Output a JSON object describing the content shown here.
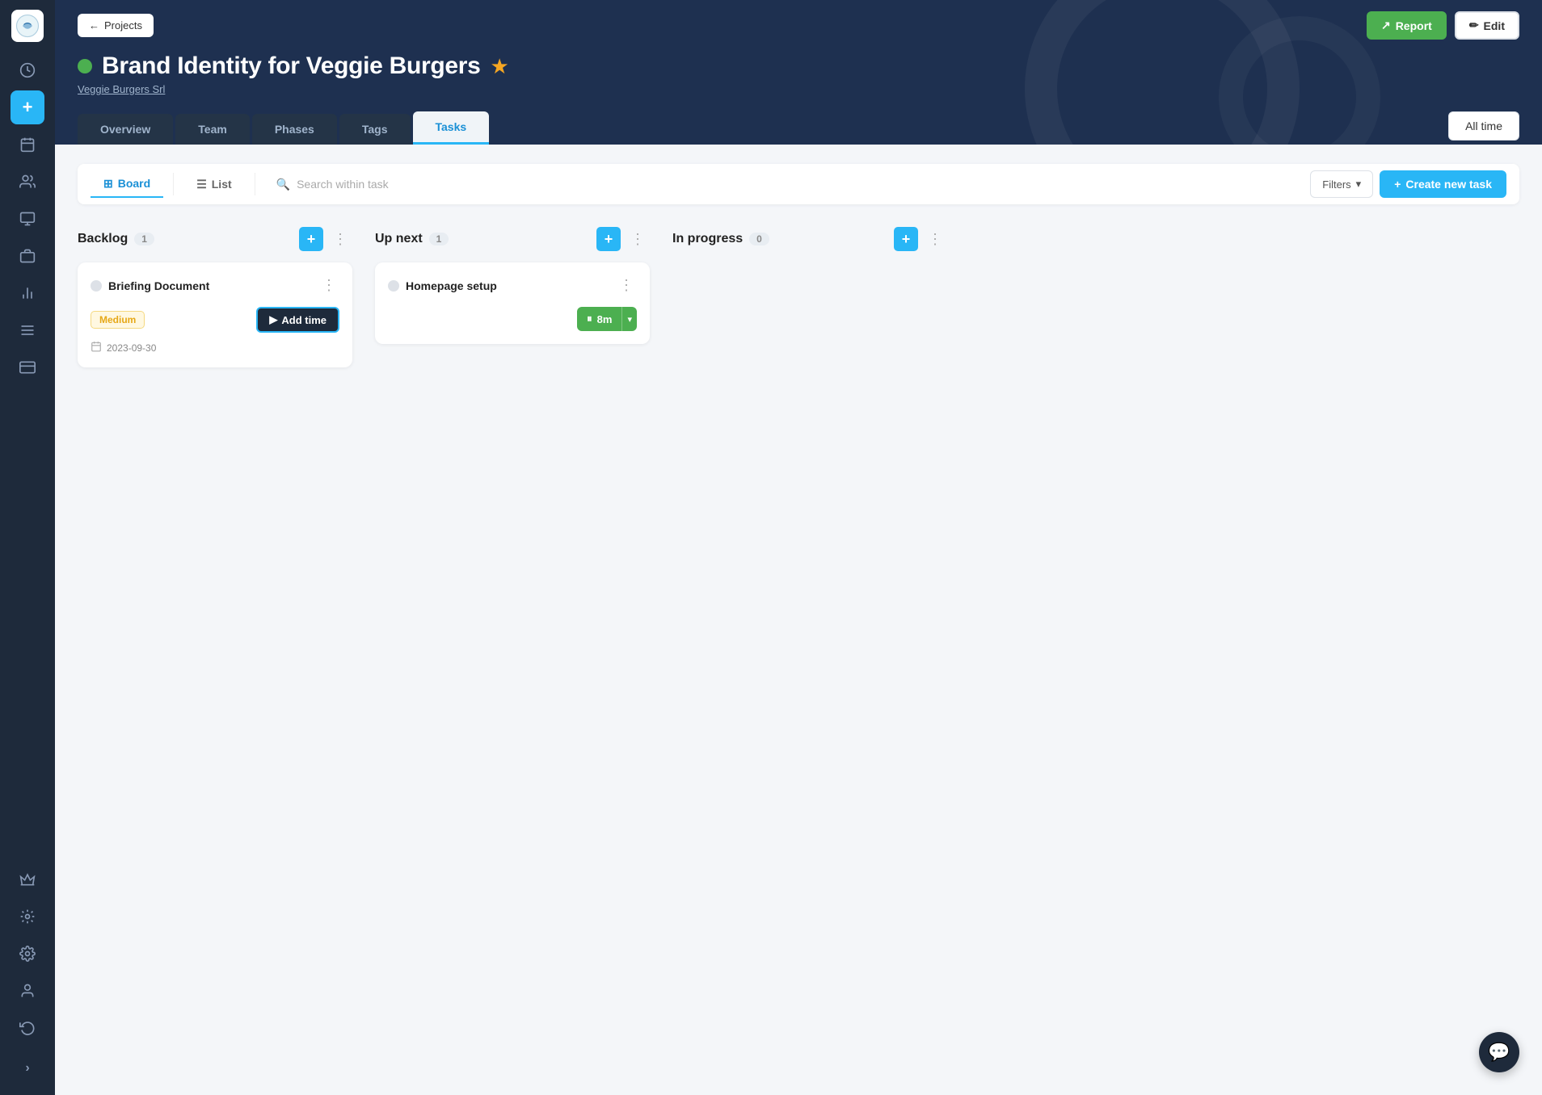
{
  "sidebar": {
    "logo_alt": "App Logo",
    "items": [
      {
        "icon": "🕐",
        "name": "time-icon",
        "active": false,
        "label": "Time"
      },
      {
        "icon": "+",
        "name": "add-icon",
        "active": true,
        "label": "Add"
      },
      {
        "icon": "📅",
        "name": "calendar-icon",
        "active": false,
        "label": "Calendar"
      },
      {
        "icon": "👥",
        "name": "team-icon",
        "active": false,
        "label": "Team"
      },
      {
        "icon": "📋",
        "name": "projects-icon",
        "active": false,
        "label": "Projects"
      },
      {
        "icon": "💼",
        "name": "portfolio-icon",
        "active": false,
        "label": "Portfolio"
      },
      {
        "icon": "📊",
        "name": "reports-icon",
        "active": false,
        "label": "Reports"
      },
      {
        "icon": "≡",
        "name": "list-icon",
        "active": false,
        "label": "List"
      },
      {
        "icon": "💳",
        "name": "billing-icon",
        "active": false,
        "label": "Billing"
      }
    ],
    "bottom_items": [
      {
        "icon": "👑",
        "name": "crown-icon",
        "label": "Crown"
      },
      {
        "icon": "⚙",
        "name": "gear-icon",
        "label": "Settings"
      },
      {
        "icon": "👤",
        "name": "profile-icon",
        "label": "Profile"
      },
      {
        "icon": "🔄",
        "name": "history-icon",
        "label": "History"
      }
    ],
    "expand_label": ">"
  },
  "header": {
    "back_label": "Projects",
    "report_label": "Report",
    "edit_label": "Edit",
    "status_color": "#4caf50",
    "project_title": "Brand Identity for Veggie Burgers",
    "star": "★",
    "client_name": "Veggie Burgers Srl",
    "time_filter": "All time",
    "tabs": [
      {
        "label": "Overview",
        "active": false
      },
      {
        "label": "Team",
        "active": false
      },
      {
        "label": "Phases",
        "active": false
      },
      {
        "label": "Tags",
        "active": false
      },
      {
        "label": "Tasks",
        "active": true
      }
    ]
  },
  "board": {
    "view_board_label": "Board",
    "view_list_label": "List",
    "search_placeholder": "Search within task",
    "filters_label": "Filters",
    "create_task_label": "Create new task",
    "columns": [
      {
        "title": "Backlog",
        "count": "1",
        "tasks": [
          {
            "title": "Briefing Document",
            "tag": "Medium",
            "has_add_time": true,
            "add_time_label": "Add time",
            "date": "2023-09-30"
          }
        ]
      },
      {
        "title": "Up next",
        "count": "1",
        "tasks": [
          {
            "title": "Homepage setup",
            "has_timer": true,
            "timer_value": "8m"
          }
        ]
      },
      {
        "title": "In progress",
        "count": "0",
        "tasks": []
      }
    ]
  },
  "chat_bubble": {
    "icon": "💬",
    "label": "Chat"
  }
}
